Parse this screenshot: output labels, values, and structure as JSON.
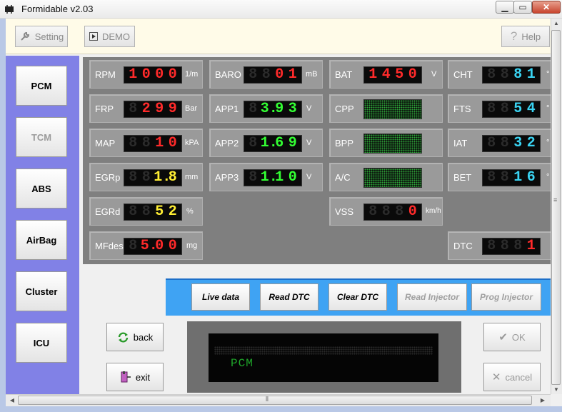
{
  "window": {
    "title": "Formidable v2.03",
    "minimize": "▁",
    "maximize": "▭",
    "close": "✕"
  },
  "toolbar": {
    "setting_label": "Setting",
    "demo_label": "DEMO",
    "help_label": "Help"
  },
  "sidebar": {
    "items": [
      {
        "label": "PCM",
        "enabled": true
      },
      {
        "label": "TCM",
        "enabled": false
      },
      {
        "label": "ABS",
        "enabled": true
      },
      {
        "label": "AirBag",
        "enabled": true
      },
      {
        "label": "Cluster",
        "enabled": true
      },
      {
        "label": "ICU",
        "enabled": true
      }
    ]
  },
  "colors": {
    "red": "#ff2a2a",
    "green": "#33ff33",
    "yellow": "#ffee33",
    "cyan": "#3ad3f2",
    "dim": "#2b2b2b",
    "sidebar": "#8181e6",
    "cmdbar": "#3fa3f3"
  },
  "gauges": {
    "rpm": {
      "label": "RPM",
      "unit": "1/m",
      "value": "1000",
      "color": "#ff2a2a"
    },
    "frp": {
      "label": "FRP",
      "unit": "Bar",
      "value": " 299",
      "color": "#ff2a2a"
    },
    "map": {
      "label": "MAP",
      "unit": "kPA",
      "value": "  10",
      "color": "#ff2a2a"
    },
    "egrp": {
      "label": "EGRp",
      "unit": "mm",
      "value": " 1.8",
      "color": "#ffee33"
    },
    "egrd": {
      "label": "EGRd",
      "unit": "%",
      "value": "  52",
      "color": "#ffee33"
    },
    "mfdes": {
      "label": "MFdes",
      "unit": "mg",
      "value": " 5.00",
      "color": "#ff2a2a"
    },
    "baro": {
      "label": "BARO",
      "unit": "mB",
      "value": "  01",
      "color": "#ff2a2a"
    },
    "app1": {
      "label": "APP1",
      "unit": "V",
      "value": "3.93",
      "color": "#33ff33"
    },
    "app2": {
      "label": "APP2",
      "unit": "V",
      "value": "1.69",
      "color": "#33ff33"
    },
    "app3": {
      "label": "APP3",
      "unit": "V",
      "value": "1.10",
      "color": "#33ff33"
    },
    "bat": {
      "label": "BAT",
      "unit": "V",
      "value": "1450",
      "color": "#ff2a2a"
    },
    "cpp": {
      "label": "CPP"
    },
    "bpp": {
      "label": "BPP"
    },
    "ac": {
      "label": "A/C"
    },
    "vss": {
      "label": "VSS",
      "unit": "km/h",
      "value": "   0",
      "color": "#ff2a2a"
    },
    "cht": {
      "label": "CHT",
      "unit": "°",
      "value": "  81",
      "color": "#3ad3f2"
    },
    "fts": {
      "label": "FTS",
      "unit": "°",
      "value": "  54",
      "color": "#3ad3f2"
    },
    "iat": {
      "label": "IAT",
      "unit": "°",
      "value": "  32",
      "color": "#3ad3f2"
    },
    "bet": {
      "label": "BET",
      "unit": "°",
      "value": "  16",
      "color": "#3ad3f2"
    },
    "dtc": {
      "label": "DTC",
      "unit": "",
      "value": "   1",
      "color": "#ff2a2a"
    }
  },
  "commands": {
    "live_data": "Live data",
    "read_dtc": "Read DTC",
    "clear_dtc": "Clear DTC",
    "read_injector": "Read Injector",
    "prog_injector": "Prog Injector"
  },
  "nav": {
    "back_label": "back",
    "exit_label": "exit",
    "ok_label": "OK",
    "cancel_label": "cancel"
  },
  "display": {
    "text": "PCM"
  }
}
